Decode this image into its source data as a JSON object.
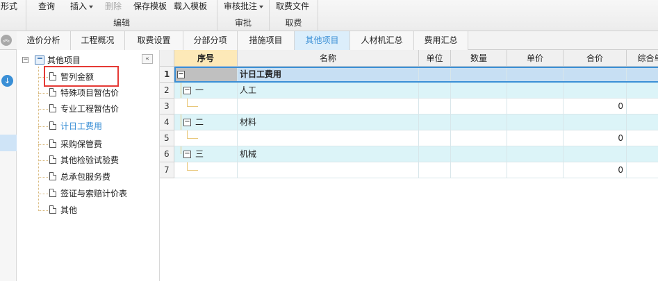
{
  "ribbon": {
    "groups": [
      {
        "buttons": [
          {
            "label": "形式"
          }
        ],
        "label": ""
      },
      {
        "buttons": [
          {
            "label": "查询"
          },
          {
            "label": "插入",
            "dropdown": true
          },
          {
            "label": "删除",
            "disabled": true
          },
          {
            "label": "保存模板"
          },
          {
            "label": "载入模板"
          }
        ],
        "label": "编辑"
      },
      {
        "buttons": [
          {
            "label": "审核批注",
            "dropdown": true
          }
        ],
        "label": "审批"
      },
      {
        "buttons": [
          {
            "label": "取费文件"
          }
        ],
        "label": "取费"
      }
    ]
  },
  "tabs": [
    "造价分析",
    "工程概况",
    "取费设置",
    "分部分项",
    "措施项目",
    "其他项目",
    "人材机汇总",
    "费用汇总"
  ],
  "active_tab": "其他项目",
  "tree": {
    "root": "其他项目",
    "items": [
      "暂列金额",
      "特殊项目暂估价",
      "专业工程暂估价",
      "计日工费用",
      "采购保管费",
      "其他检验试验费",
      "总承包服务费",
      "签证与索赔计价表",
      "其他"
    ],
    "selected": "计日工费用"
  },
  "grid": {
    "columns": [
      "序号",
      "名称",
      "单位",
      "数量",
      "单价",
      "合价",
      "综合单"
    ],
    "rows": [
      {
        "num": "1",
        "seq": "",
        "name": "计日工费用",
        "total": ""
      },
      {
        "num": "2",
        "seq": "一",
        "name": "人工",
        "total": ""
      },
      {
        "num": "3",
        "seq": "",
        "name": "",
        "total": "0"
      },
      {
        "num": "4",
        "seq": "二",
        "name": "材料",
        "total": ""
      },
      {
        "num": "5",
        "seq": "",
        "name": "",
        "total": "0"
      },
      {
        "num": "6",
        "seq": "三",
        "name": "机械",
        "total": ""
      },
      {
        "num": "7",
        "seq": "",
        "name": "",
        "total": "0"
      }
    ]
  },
  "colors": {
    "accent": "#3a8fd6",
    "highlight": "#e53935",
    "group_row": "#dcf4f8"
  }
}
